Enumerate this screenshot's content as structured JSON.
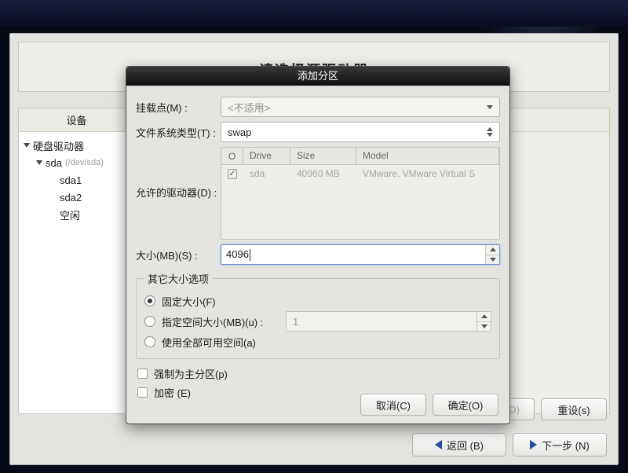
{
  "back_window": {
    "truncated_title": "请选择源驱动器",
    "device_col": "设备",
    "tree": {
      "root": "硬盘驱动器",
      "disk": "sda",
      "disk_hint": "(/dev/sda)",
      "parts": [
        "sda1",
        "sda2",
        "空闲"
      ]
    },
    "buttons": {
      "d": "(D)",
      "reset": "重设(s)",
      "back": "返回 (B)",
      "next": "下一步 (N)"
    }
  },
  "dialog": {
    "title": "添加分区",
    "mount_label": "挂载点(M) :",
    "mount_value": "<不适用>",
    "fstype_label": "文件系统类型(T) :",
    "fstype_value": "swap",
    "drives_label": "允许的驱动器(D) :",
    "drive_headers": {
      "o": "O",
      "drive": "Drive",
      "size": "Size",
      "model": "Model"
    },
    "drive_row": {
      "name": "sda",
      "size": "40960 MB",
      "model": "VMware, VMware Virtual S"
    },
    "size_label": "大小(MB)(S) :",
    "size_value": "4096",
    "group_label": "其它大小选项",
    "radio_fixed": "固定大小(F)",
    "radio_upto": "指定空间大小(MB)(u) :",
    "upto_value": "1",
    "radio_all": "使用全部可用空间(a)",
    "cb_primary": "强制为主分区(p)",
    "cb_encrypt": "加密 (E)",
    "btn_cancel": "取消(C)",
    "btn_ok": "确定(O)"
  }
}
